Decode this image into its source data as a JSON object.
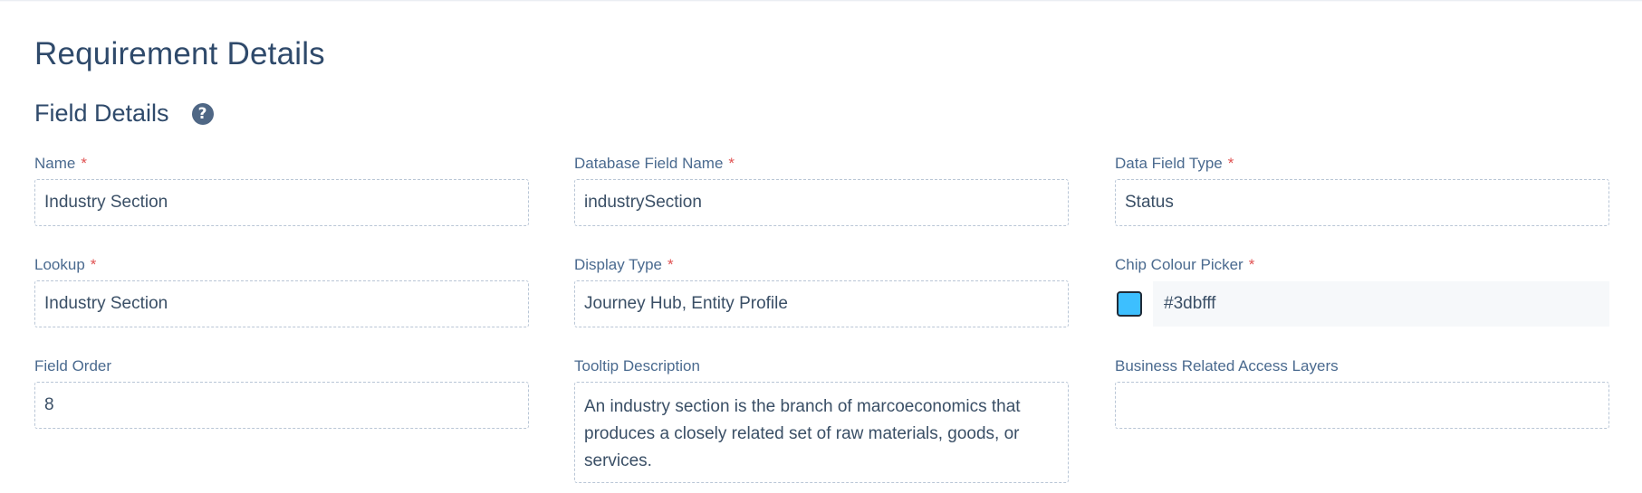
{
  "page": {
    "title": "Requirement Details",
    "section_title": "Field Details"
  },
  "fields": {
    "name": {
      "label": "Name",
      "required": "*",
      "value": "Industry Section"
    },
    "db_field_name": {
      "label": "Database Field Name",
      "required": "*",
      "value": "industrySection"
    },
    "data_field_type": {
      "label": "Data Field Type",
      "required": "*",
      "value": "Status"
    },
    "lookup": {
      "label": "Lookup",
      "required": "*",
      "value": "Industry Section"
    },
    "display_type": {
      "label": "Display Type",
      "required": "*",
      "value": "Journey Hub, Entity Profile"
    },
    "chip_colour": {
      "label": "Chip Colour Picker",
      "required": "*",
      "value": "#3dbfff"
    },
    "field_order": {
      "label": "Field Order",
      "value": "8"
    },
    "tooltip": {
      "label": "Tooltip Description",
      "value": "An industry section is the branch of marcoeconomics that produces a closely related set of raw materials, goods, or services."
    },
    "access_layers": {
      "label": "Business Related Access Layers",
      "value": ""
    }
  },
  "icons": {
    "help": "question-circle-icon"
  },
  "colors": {
    "text": "#2f4a6b",
    "label": "#4a6a8f",
    "required": "#e05252",
    "chip": "#3dbfff"
  }
}
